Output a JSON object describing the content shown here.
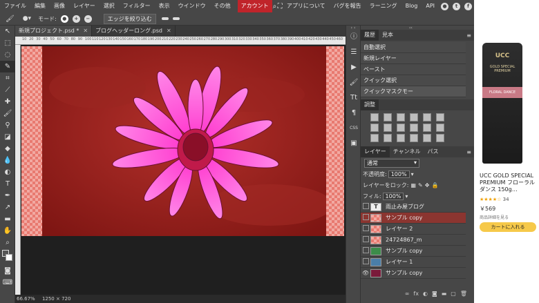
{
  "menubar": {
    "items": [
      "ファイル",
      "編集",
      "画像",
      "レイヤー",
      "選択",
      "フィルター",
      "表示",
      "ウインドウ",
      "その他"
    ],
    "account": "アカウント",
    "right_links": [
      "アプリについて",
      "バグを報告",
      "ラーニング",
      "Blog",
      "API"
    ]
  },
  "options": {
    "mode_label": "モード:",
    "refine_edge": "エッジを絞り込む"
  },
  "tabs": [
    {
      "label": "新規プロジェクト.psd *"
    },
    {
      "label": "ブログヘッダーロング.psd"
    }
  ],
  "ruler_ticks": [
    "10",
    "20",
    "30",
    "40",
    "50",
    "60",
    "70",
    "80",
    "90",
    "100",
    "110",
    "120",
    "130",
    "140",
    "150",
    "160",
    "170",
    "180",
    "190",
    "200",
    "210",
    "220",
    "230",
    "240",
    "250",
    "260",
    "270",
    "280",
    "290",
    "300",
    "310",
    "320",
    "330",
    "340",
    "350",
    "360",
    "370",
    "380",
    "390",
    "400",
    "410",
    "420",
    "430",
    "440",
    "450",
    "460"
  ],
  "status": {
    "zoom": "66.67%",
    "size": "1250 × 720"
  },
  "panel": {
    "top_tabs": [
      "履歴",
      "見本"
    ],
    "history": [
      "自動選択",
      "新規レイヤー",
      "ペースト",
      "クイック選択",
      "クイックマスクモー"
    ],
    "adjust_title": "調整",
    "layer_tabs": [
      "レイヤー",
      "チャンネル",
      "パス"
    ],
    "blend_mode": "通常",
    "opacity_label": "不透明度:",
    "opacity_value": "100%",
    "lock_label": "レイヤーをロック:",
    "fill_label": "フィル:",
    "fill_value": "100%",
    "layers": [
      {
        "name": "雨止み屋ブログ",
        "type": "text"
      },
      {
        "name": "サンプル copy",
        "selected": true
      },
      {
        "name": "レイヤー 2"
      },
      {
        "name": "24724867_m"
      },
      {
        "name": "サンプル copy"
      },
      {
        "name": "レイヤー 1"
      },
      {
        "name": "サンプル copy",
        "visible": true
      }
    ]
  },
  "ad": {
    "brand": "UCC",
    "line1": "GOLD SPECIAL",
    "line2": "PREMIUM",
    "pack_label": "FLORAL DANCE",
    "title": "UCC GOLD SPECIAL PREMIUM フローラルダンス 150g…",
    "rating_count": "34",
    "price": "￥569",
    "details": "商品詳細を見る",
    "cart": "カートに入れる"
  },
  "colors": {
    "accent": "#c0242a",
    "selected_layer": "#8b3530",
    "canvas_red": "#8e1b18",
    "flower": "#ff4fd6"
  }
}
